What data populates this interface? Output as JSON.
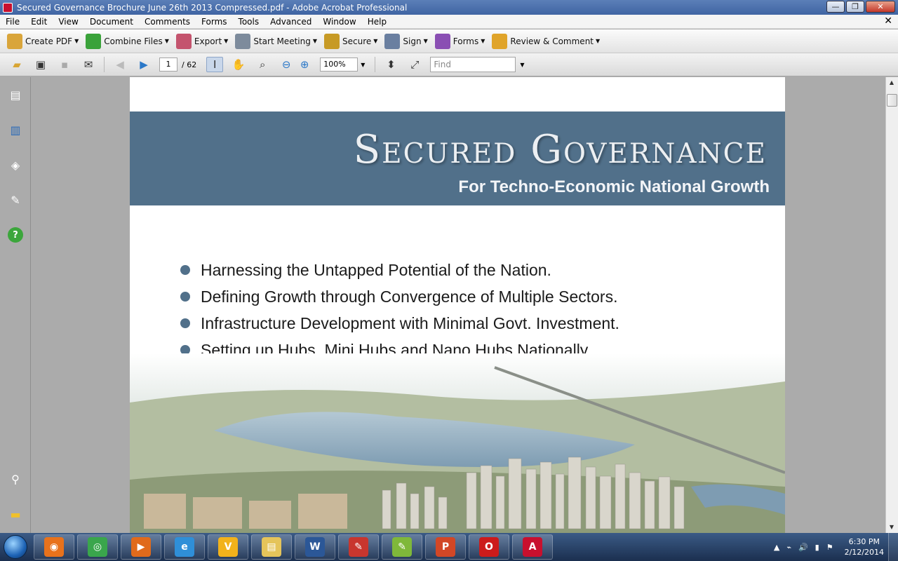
{
  "window": {
    "title": "Secured Governance Brochure June 26th   2013 Compressed.pdf - Adobe Acrobat Professional",
    "min_glyph": "—",
    "max_glyph": "❐",
    "close_glyph": "✕"
  },
  "menu": [
    "File",
    "Edit",
    "View",
    "Document",
    "Comments",
    "Forms",
    "Tools",
    "Advanced",
    "Window",
    "Help"
  ],
  "menu_close": "✕",
  "toolbar1": [
    {
      "label": "Create PDF",
      "icon": "create-pdf-icon",
      "color": "#d9a53b"
    },
    {
      "label": "Combine Files",
      "icon": "combine-files-icon",
      "color": "#3aa23a"
    },
    {
      "label": "Export",
      "icon": "export-icon",
      "color": "#c4546e"
    },
    {
      "label": "Start Meeting",
      "icon": "start-meeting-icon",
      "color": "#7d8b9c"
    },
    {
      "label": "Secure",
      "icon": "lock-icon",
      "color": "#c79a25"
    },
    {
      "label": "Sign",
      "icon": "sign-pen-icon",
      "color": "#6a7fa0"
    },
    {
      "label": "Forms",
      "icon": "forms-icon",
      "color": "#8a4fb3"
    },
    {
      "label": "Review & Comment",
      "icon": "review-comment-icon",
      "color": "#e0a42a"
    }
  ],
  "toolbar2": {
    "page_current": "1",
    "page_total": "/ 62",
    "zoom": "100%",
    "find_placeholder": "Find"
  },
  "document": {
    "banner_title": "Secured Governance",
    "banner_subtitle": "For Techno-Economic National Growth",
    "bullets": [
      "Harnessing the Untapped Potential of the Nation.",
      "Defining Growth through Convergence of Multiple Sectors.",
      "Infrastructure Development with Minimal Govt. Investment.",
      "Setting up Hubs, Mini Hubs and Nano Hubs Nationally."
    ],
    "accent_color": "#51708a"
  },
  "taskbar": {
    "apps": [
      {
        "name": "firefox",
        "color": "#e8721c",
        "glyph": "◉"
      },
      {
        "name": "chrome",
        "color": "#3aa64c",
        "glyph": "◎"
      },
      {
        "name": "media-player",
        "color": "#e06a1b",
        "glyph": "▶"
      },
      {
        "name": "internet-explorer",
        "color": "#2f8fd8",
        "glyph": "e"
      },
      {
        "name": "vlc-like-v",
        "color": "#f2b21b",
        "glyph": "V"
      },
      {
        "name": "file-explorer",
        "color": "#e5c45a",
        "glyph": "▤"
      },
      {
        "name": "word",
        "color": "#2b5797",
        "glyph": "W"
      },
      {
        "name": "pdf-reader-red",
        "color": "#c8362e",
        "glyph": "✎"
      },
      {
        "name": "notepad-green",
        "color": "#7fb83a",
        "glyph": "✎"
      },
      {
        "name": "powerpoint",
        "color": "#d24726",
        "glyph": "P"
      },
      {
        "name": "opera",
        "color": "#cc1b1b",
        "glyph": "O"
      },
      {
        "name": "adobe-acrobat",
        "color": "#c8102e",
        "glyph": "A"
      }
    ],
    "tray_glyphs": [
      "▲",
      "⌁",
      "🔊",
      "▮",
      "⚑"
    ],
    "time": "6:30 PM",
    "date": "2/12/2014"
  }
}
